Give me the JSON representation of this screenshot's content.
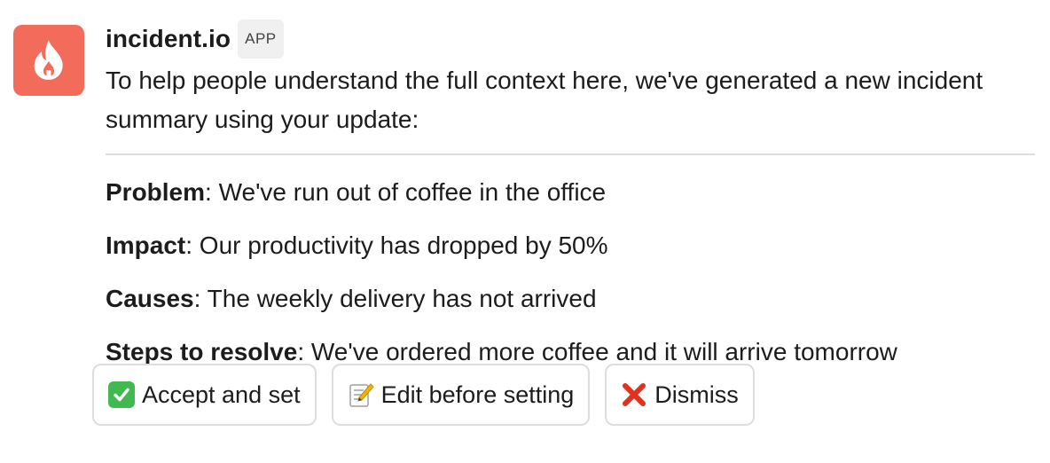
{
  "app": {
    "name": "incident.io",
    "badge": "APP",
    "brand_color": "#f26b5b",
    "avatar_icon": "flame-icon"
  },
  "message": {
    "intro": "To help people understand the full context here, we've generated a new incident summary using your update:"
  },
  "summary": [
    {
      "label": "Problem",
      "value": ": We've run out of coffee in the office"
    },
    {
      "label": "Impact",
      "value": ": Our productivity has dropped by 50%"
    },
    {
      "label": "Causes",
      "value": ": The weekly delivery has not arrived"
    },
    {
      "label": "Steps to resolve",
      "value": ": We've ordered more coffee and it will arrive tomorrow"
    }
  ],
  "actions": {
    "accept": {
      "label": "Accept and set",
      "icon": "check-mark-icon"
    },
    "edit": {
      "label": "Edit before setting",
      "icon": "memo-icon"
    },
    "dismiss": {
      "label": "Dismiss",
      "icon": "cross-mark-icon"
    }
  }
}
